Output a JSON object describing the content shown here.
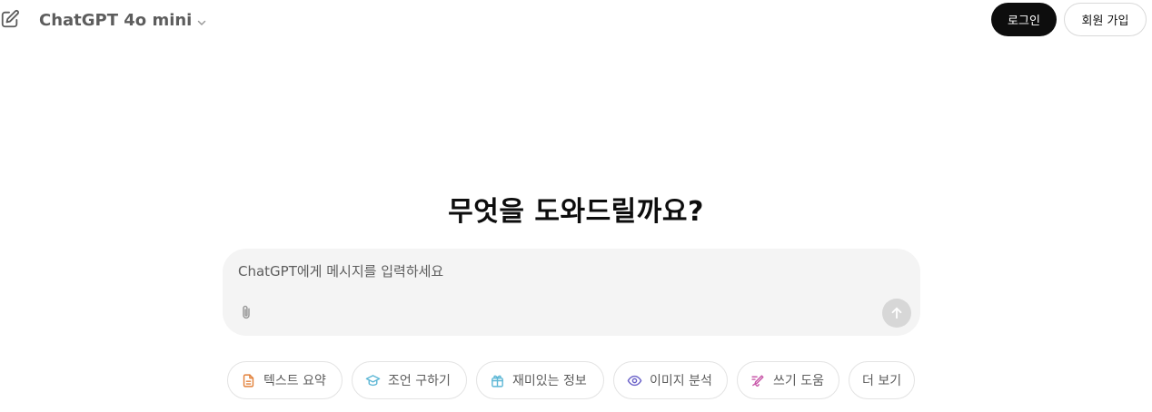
{
  "header": {
    "model_name": "ChatGPT 4o mini",
    "login_label": "로그인",
    "signup_label": "회원 가입"
  },
  "main": {
    "heading": "무엇을 도와드릴까요?"
  },
  "composer": {
    "placeholder": "ChatGPT에게 메시지를 입력하세요",
    "value": ""
  },
  "suggestions": [
    {
      "label": "텍스트 요약",
      "icon": "document-icon",
      "color": "#e2813a"
    },
    {
      "label": "조언 구하기",
      "icon": "graduation-cap-icon",
      "color": "#5fb8d6"
    },
    {
      "label": "재미있는 정보",
      "icon": "gift-icon",
      "color": "#5fb8d6"
    },
    {
      "label": "이미지 분석",
      "icon": "eye-icon",
      "color": "#6c63c9"
    },
    {
      "label": "쓰기 도움",
      "icon": "pen-icon",
      "color": "#c858a9"
    },
    {
      "label": "더 보기",
      "icon": "",
      "color": ""
    }
  ],
  "colors": {
    "primary_button": "#0d0d0d",
    "composer_bg": "#f4f4f4",
    "send_disabled": "#d7d7d7"
  }
}
